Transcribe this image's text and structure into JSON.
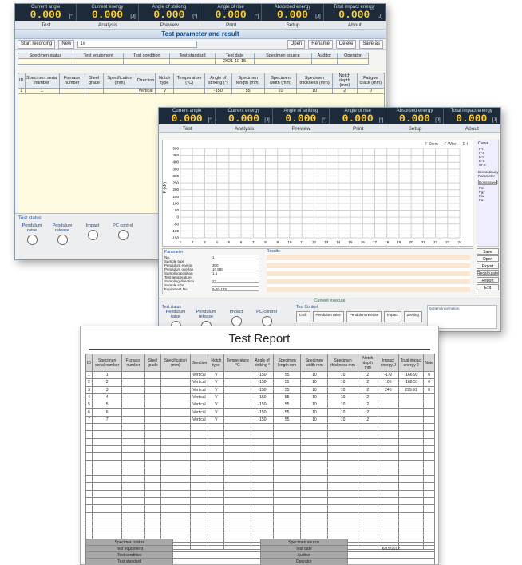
{
  "readouts": [
    {
      "label": "Current angle",
      "value": "0.000",
      "unit": "[°]"
    },
    {
      "label": "Current energy",
      "value": "0.000",
      "unit": "[J]"
    },
    {
      "label": "Angle of striking",
      "value": "0.000",
      "unit": "[°]"
    },
    {
      "label": "Angle of rise",
      "value": "0.000",
      "unit": "[°]"
    },
    {
      "label": "Absorbed energy",
      "value": "0.000",
      "unit": "[J]"
    },
    {
      "label": "Total impact energy",
      "value": "0.000",
      "unit": "[J]"
    }
  ],
  "menu": [
    "Test",
    "Analysis",
    "Preview",
    "Print",
    "Setup",
    "About"
  ],
  "win1": {
    "title": "Test parameter and result",
    "start_label": "Start recording",
    "new_label": "New",
    "search_value": "1#",
    "open_label": "Open",
    "rename_label": "Rename",
    "delete_label": "Delete",
    "saveas_label": "Save as",
    "meta_headers": [
      "Specimen status",
      "Test equipment",
      "Test condition",
      "Test standard",
      "Test date",
      "Specimen source",
      "Auditor",
      "Operator"
    ],
    "test_date": "2021-10-15",
    "headers": [
      "ID",
      "Specimen serial number",
      "Furnace number",
      "Steel grade",
      "Specification (mm)",
      "Direction",
      "Notch type",
      "Temperature (°C)",
      "Angle of striking (°)",
      "Specimen length (mm)",
      "Specimen width (mm)",
      "Specimen thickness (mm)",
      "Notch depth (mm)",
      "Fatigue crack (mm)"
    ],
    "row": [
      "1",
      "1",
      "",
      "",
      "",
      "Vertical",
      "V",
      "",
      "-150",
      "55",
      "10",
      "10",
      "2",
      "0"
    ],
    "status_title": "Test status",
    "status_items": [
      "Pendulum raise",
      "Pendulum release",
      "Impact",
      "PC control"
    ]
  },
  "win2": {
    "legend": [
      "F-Stem",
      "F-Wfer",
      "E-t"
    ],
    "curve_title": "Curve",
    "curve_options": [
      "F-t",
      "F-S",
      "E-t",
      "E-S",
      "W-S"
    ],
    "dp_title": "Discontinuity Parameter",
    "dp_select": "Downtowed",
    "dp_options": [
      "Fm",
      "Fgy",
      "Fiu",
      "Fa"
    ],
    "y_ticks": [
      "500",
      "450",
      "400",
      "350",
      "300",
      "250",
      "200",
      "150",
      "100",
      "50",
      "0",
      "-50",
      "-100",
      "-150"
    ],
    "x_ticks": [
      "1",
      "2",
      "3",
      "4",
      "5",
      "6",
      "7",
      "8",
      "9",
      "10",
      "11",
      "12",
      "13",
      "14",
      "15",
      "16",
      "17",
      "18",
      "19",
      "20",
      "21",
      "22",
      "23",
      "24"
    ],
    "yaxis_label": "F (kN)",
    "side_buttons": [
      "Save",
      "Open",
      "Export",
      "Recalculate",
      "Report",
      "Exit"
    ],
    "param_title": "Parameter",
    "results_title": "Results",
    "params": [
      "No.",
      "Sample type",
      "Pendulum energy",
      "Pendulum overlap",
      "Sampling position",
      "Test temperature",
      "Sampling direction",
      "Sample size",
      "Equipment No."
    ],
    "param_values": [
      "1",
      "",
      "300",
      "10.580",
      "1.5",
      "",
      "23",
      "",
      "5-20-145"
    ],
    "results_label": "Results",
    "control_title": "Current execute",
    "test_status": "Test status",
    "test_control": "Test Control",
    "control_buttons": [
      "Lock",
      "Pendulum raise",
      "Pendulum release",
      "Impact",
      "Zeroing"
    ],
    "system_info": "System information",
    "status_items": [
      "Pendulum raise",
      "Pendulum release",
      "Impact",
      "PC control"
    ]
  },
  "report": {
    "title": "Test Report",
    "headers": [
      "ID",
      "Specimen serial number",
      "Furnace number",
      "Steel grade",
      "Specification (mm)",
      "Direction",
      "Notch type",
      "Temperature °C",
      "Angle of striking °",
      "Specimen length mm",
      "Specimen width mm",
      "Specimen thickness mm",
      "Notch depth mm",
      "Impact energy J",
      "Total impact energy J",
      "Note"
    ],
    "material_label": "Material",
    "rows": [
      [
        "1",
        "1",
        "",
        "",
        "",
        "Vertical",
        "V",
        "",
        "-150",
        "55",
        "10",
        "10",
        "2",
        "-172",
        "-166.93",
        "0"
      ],
      [
        "2",
        "2",
        "",
        "",
        "",
        "Vertical",
        "V",
        "",
        "-150",
        "55",
        "10",
        "10",
        "2",
        "106",
        "-188.51",
        "0"
      ],
      [
        "3",
        "3",
        "",
        "",
        "",
        "Vertical",
        "V",
        "",
        "-150",
        "55",
        "10",
        "10",
        "2",
        "245",
        "299.91",
        "0"
      ],
      [
        "4",
        "4",
        "",
        "",
        "",
        "Vertical",
        "V",
        "",
        "-150",
        "55",
        "10",
        "10",
        "2",
        "",
        "",
        ""
      ],
      [
        "5",
        "5",
        "",
        "",
        "",
        "Vertical",
        "V",
        "",
        "-150",
        "55",
        "10",
        "10",
        "2",
        "",
        "",
        ""
      ],
      [
        "6",
        "6",
        "",
        "",
        "",
        "Vertical",
        "V",
        "",
        "-150",
        "55",
        "10",
        "10",
        "2",
        "",
        "",
        ""
      ],
      [
        "7",
        "7",
        "",
        "",
        "",
        "Vertical",
        "V",
        "",
        "-150",
        "55",
        "10",
        "10",
        "2",
        "",
        "",
        ""
      ]
    ],
    "footer": [
      [
        "Specimen status",
        "",
        "Specimen source",
        ""
      ],
      [
        "Test equipment",
        "",
        "Test date",
        "6/15/2012"
      ],
      [
        "Test condition",
        "",
        "Auditor",
        ""
      ],
      [
        "Test standard",
        "",
        "Operator",
        ""
      ]
    ]
  }
}
